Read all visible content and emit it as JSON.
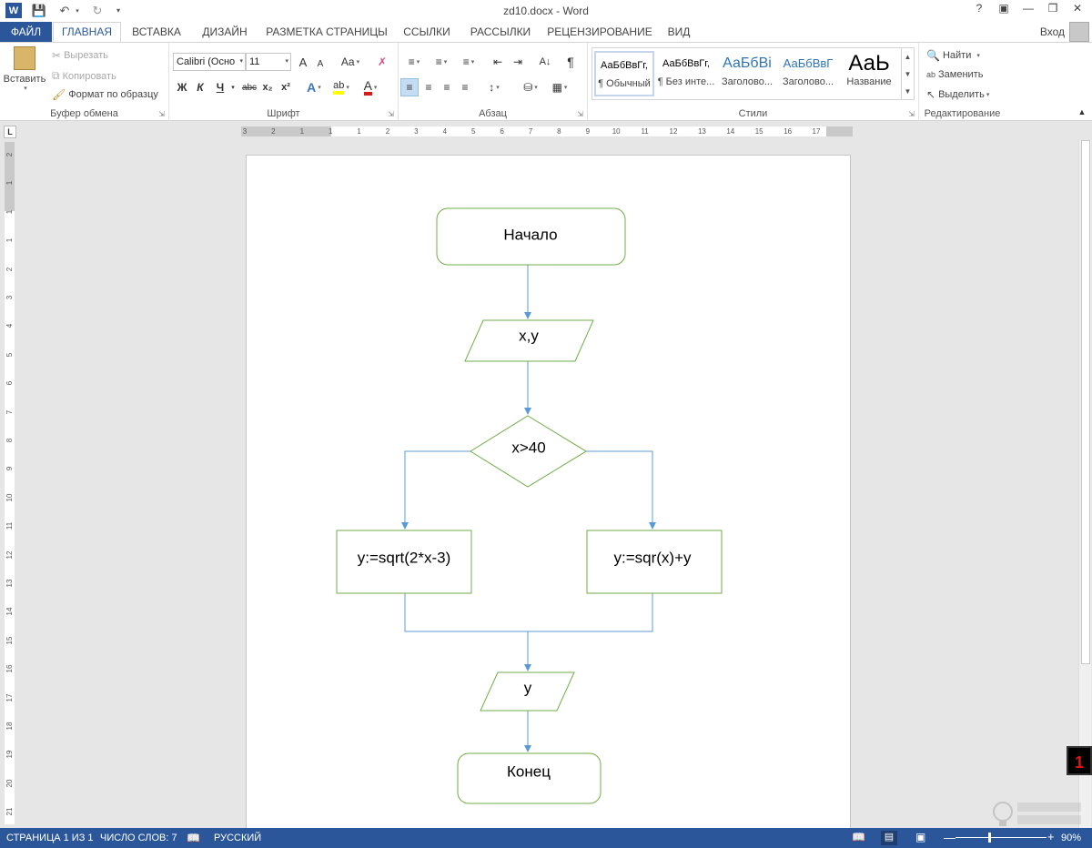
{
  "window": {
    "title": "zd10.docx - Word",
    "help": "?",
    "signin": "Вход"
  },
  "tabs": [
    "ФАЙЛ",
    "ГЛАВНАЯ",
    "ВСТАВКА",
    "ДИЗАЙН",
    "РАЗМЕТКА СТРАНИЦЫ",
    "ССЫЛКИ",
    "РАССЫЛКИ",
    "РЕЦЕНЗИРОВАНИЕ",
    "ВИД"
  ],
  "clipboard": {
    "paste": "Вставить",
    "cut": "Вырезать",
    "copy": "Копировать",
    "format_painter": "Формат по образцу",
    "label": "Буфер обмена"
  },
  "font": {
    "name": "Calibri (Осно",
    "size": "11",
    "bold": "Ж",
    "italic": "К",
    "underline": "Ч",
    "strike": "abc",
    "subscript": "x₂",
    "superscript": "x²",
    "case": "Aa",
    "grow": "A",
    "shrink": "A",
    "effects": "A",
    "highlight": "ab",
    "color": "A",
    "label": "Шрифт",
    "highlight_color": "#ffff00",
    "font_color": "#d41c1c"
  },
  "paragraph": {
    "label": "Абзац",
    "sort": "A↓",
    "marks": "¶"
  },
  "styles": {
    "label": "Стили",
    "items": [
      {
        "preview": "АаБбВвГг,",
        "name": "¶ Обычный"
      },
      {
        "preview": "АаБбВвГг,",
        "name": "¶ Без инте..."
      },
      {
        "preview": "АаБбВі",
        "name": "Заголово..."
      },
      {
        "preview": "АаБбВвГ",
        "name": "Заголово..."
      },
      {
        "preview": "АаЬ",
        "name": "Название"
      }
    ]
  },
  "editing": {
    "label": "Редактирование",
    "find": "Найти",
    "replace": "Заменить",
    "select": "Выделить"
  },
  "hruler_ticks": [
    "3",
    "2",
    "1",
    "1",
    "1",
    "2",
    "3",
    "4",
    "5",
    "6",
    "7",
    "8",
    "9",
    "10",
    "11",
    "12",
    "13",
    "14",
    "15",
    "16",
    "17"
  ],
  "vruler_ticks": [
    "2",
    "1",
    "1",
    "1",
    "2",
    "3",
    "4",
    "5",
    "6",
    "7",
    "8",
    "9",
    "10",
    "11",
    "12",
    "13",
    "14",
    "15",
    "16",
    "17",
    "18",
    "19",
    "20",
    "21"
  ],
  "flowchart": {
    "start": "Начало",
    "input": "x,y",
    "condition": "x>40",
    "yes_branch": "y:=sqrt(2*x-3)",
    "no_branch": "y:=sqr(x)+y",
    "output": "y",
    "end": "Конец",
    "terminator_color": "#70ad47",
    "arrow_color": "#5b9bd5"
  },
  "status": {
    "page": "СТРАНИЦА 1 ИЗ 1",
    "words": "ЧИСЛО СЛОВ: 7",
    "language": "РУССКИЙ",
    "zoom": "90%"
  },
  "overlay": {
    "badge": "1"
  }
}
